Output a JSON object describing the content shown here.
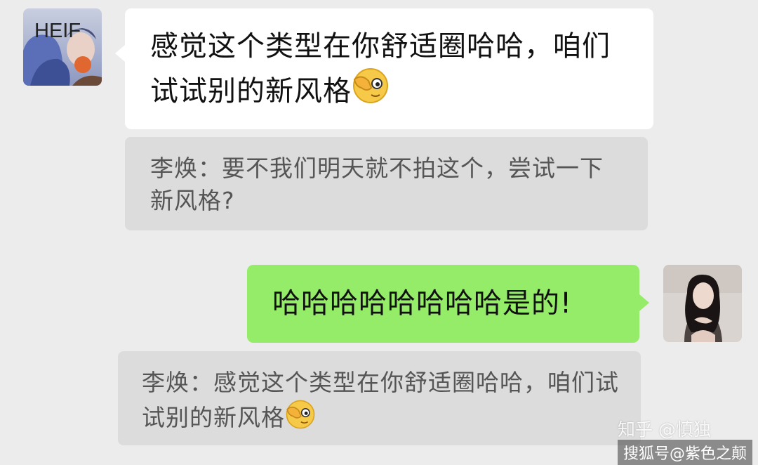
{
  "avatars": {
    "left_label": "HEIF"
  },
  "messages": [
    {
      "kind": "received",
      "text": "感觉这个类型在你舒适圈哈哈，咱们试试别的新风格",
      "emoji": "face-with-hand-over-eye-icon"
    },
    {
      "kind": "quote",
      "text": "李焕：要不我们明天就不拍这个，尝试一下新风格?"
    },
    {
      "kind": "sent",
      "text": "哈哈哈哈哈哈哈哈是的!"
    },
    {
      "kind": "quote",
      "text": "李焕：感觉这个类型在你舒适圈哈哈，咱们试试别的新风格",
      "emoji": "face-with-hand-over-eye-icon"
    }
  ],
  "watermarks": {
    "line1": "知乎 @慎独",
    "line2": "搜狐号@紫色之颠"
  },
  "colors": {
    "background": "#ececec",
    "received_bubble": "#ffffff",
    "sent_bubble": "#95ec69",
    "quote_bubble": "#dcdcdc",
    "quote_text": "#555555"
  }
}
